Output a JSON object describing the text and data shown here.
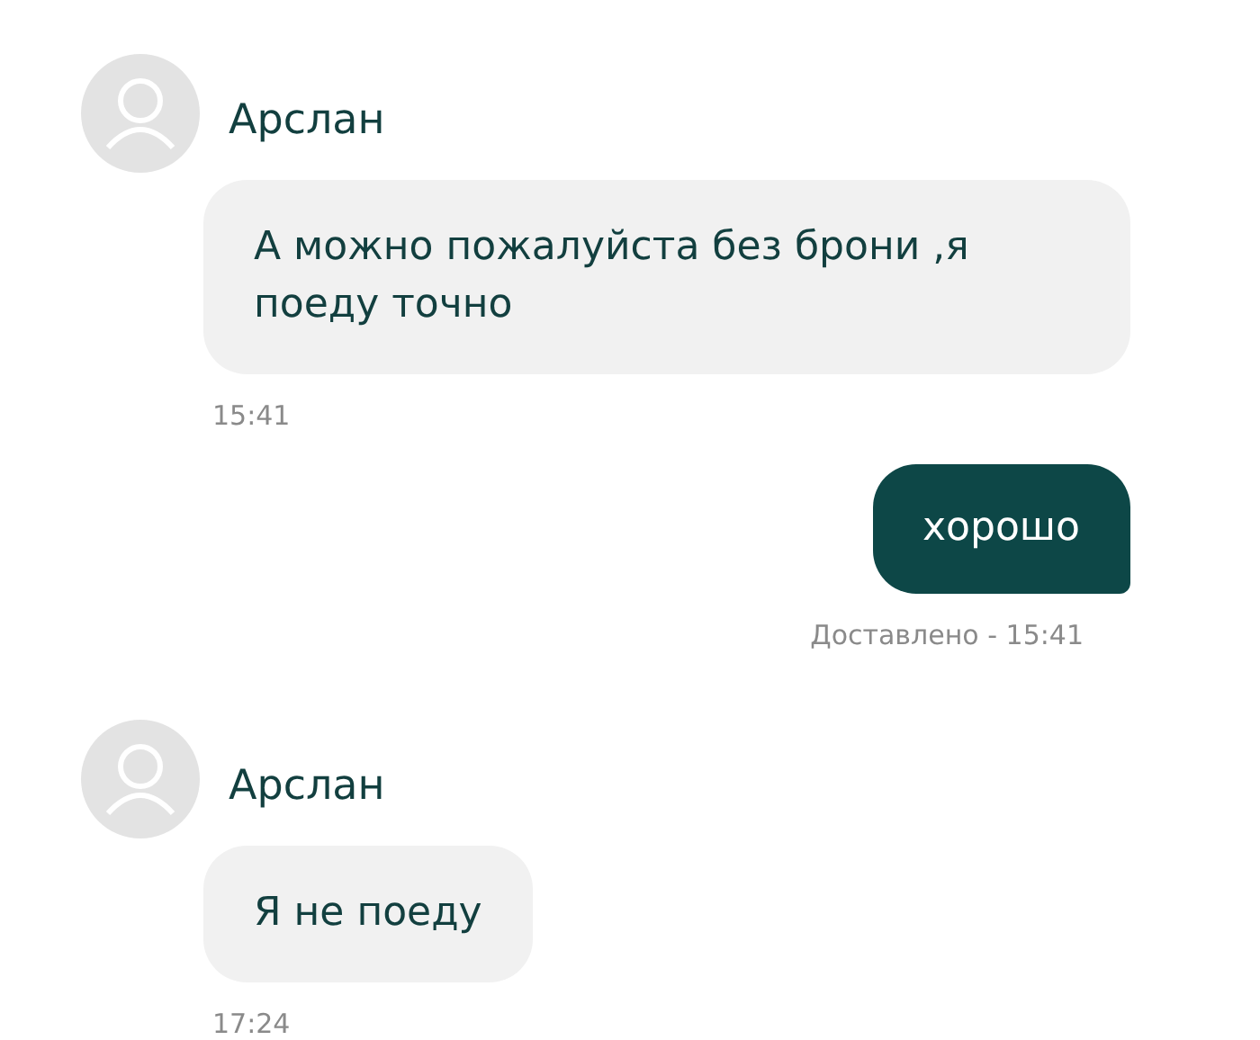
{
  "messages": [
    {
      "kind": "incoming",
      "sender": "Арслан",
      "text": "А можно пожалуйста без брони ,я поеду точно",
      "time": "15:41"
    },
    {
      "kind": "outgoing",
      "text": "хорошо",
      "status": "Доставлено - 15:41"
    },
    {
      "kind": "incoming",
      "sender": "Арслан",
      "text": "Я не поеду",
      "time": "17:24"
    }
  ]
}
